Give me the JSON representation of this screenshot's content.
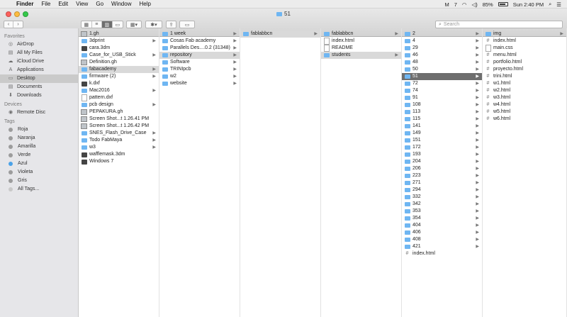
{
  "menubar": {
    "app": "Finder",
    "items": [
      "File",
      "Edit",
      "View",
      "Go",
      "Window",
      "Help"
    ],
    "status_num": "7",
    "battery_text": "85%",
    "battery_level": 0.85,
    "clock": "Sun 2:40 PM"
  },
  "window": {
    "title": "51"
  },
  "toolbar": {
    "search_placeholder": "Search"
  },
  "sidebar": {
    "favorites_header": "Favorites",
    "favorites": [
      "AirDrop",
      "All My Files",
      "iCloud Drive",
      "Applications",
      "Desktop",
      "Documents",
      "Downloads"
    ],
    "devices_header": "Devices",
    "devices": [
      "Remote Disc"
    ],
    "tags_header": "Tags",
    "tags": [
      {
        "label": "Roja",
        "color": "#9c9c9c"
      },
      {
        "label": "Naranja",
        "color": "#9c9c9c"
      },
      {
        "label": "Amarilla",
        "color": "#9c9c9c"
      },
      {
        "label": "Verde",
        "color": "#9c9c9c"
      },
      {
        "label": "Azul",
        "color": "#4aa2e8"
      },
      {
        "label": "Violeta",
        "color": "#9c9c9c"
      },
      {
        "label": "Gris",
        "color": "#9c9c9c"
      },
      {
        "label": "All Tags...",
        "color": "#c9c9c9"
      }
    ]
  },
  "columns": [
    [
      {
        "label": "1.gh",
        "icon": "image"
      },
      {
        "label": "3dprint",
        "icon": "folder",
        "chev": true
      },
      {
        "label": "cara.3dm",
        "icon": "dark"
      },
      {
        "label": "Case_for_USB_Stick",
        "icon": "folder",
        "chev": true
      },
      {
        "label": "Definition.gh",
        "icon": "image"
      },
      {
        "label": "fabacademy",
        "icon": "folder",
        "chev": true,
        "sel": "grey"
      },
      {
        "label": "firmware (2)",
        "icon": "folder",
        "chev": true
      },
      {
        "label": "k.dxf",
        "icon": "dark"
      },
      {
        "label": "Mac2016",
        "icon": "folder",
        "chev": true
      },
      {
        "label": "pattern.dxf",
        "icon": "file"
      },
      {
        "label": "pcb design",
        "icon": "folder",
        "chev": true
      },
      {
        "label": "PEPAKURA.gh",
        "icon": "image"
      },
      {
        "label": "Screen Shot...t 1.26.41 PM",
        "icon": "image"
      },
      {
        "label": "Screen Shot...t 1.26.42 PM",
        "icon": "image"
      },
      {
        "label": "SNES_Flash_Drive_Case",
        "icon": "folder",
        "chev": true
      },
      {
        "label": "Todo FabMaya",
        "icon": "folder",
        "chev": true
      },
      {
        "label": "w3",
        "icon": "folder",
        "chev": true
      },
      {
        "label": "wafflemask.3dm",
        "icon": "dark"
      },
      {
        "label": "Windows 7",
        "icon": "dark"
      }
    ],
    [
      {
        "label": "1 week",
        "icon": "folder",
        "chev": true
      },
      {
        "label": "Cosas Fab academy",
        "icon": "folder",
        "chev": true
      },
      {
        "label": "Parallels Des....0.2 (31348)",
        "icon": "folder",
        "chev": true
      },
      {
        "label": "repository",
        "icon": "folder",
        "chev": true,
        "sel": "grey"
      },
      {
        "label": "Software",
        "icon": "folder",
        "chev": true
      },
      {
        "label": "TRINIpcb",
        "icon": "folder",
        "chev": true
      },
      {
        "label": "w2",
        "icon": "folder",
        "chev": true
      },
      {
        "label": "website",
        "icon": "folder",
        "chev": true
      }
    ],
    [
      {
        "label": "fablabbcn",
        "icon": "folder",
        "chev": true,
        "sel": "grey"
      }
    ],
    [
      {
        "label": "fablabbcn",
        "icon": "folder",
        "chev": true
      },
      {
        "label": "index.html",
        "icon": "file"
      },
      {
        "label": "README",
        "icon": "file"
      },
      {
        "label": "students",
        "icon": "folder",
        "chev": true,
        "sel": "grey"
      }
    ],
    [
      {
        "label": "2",
        "icon": "folder",
        "chev": true
      },
      {
        "label": "4",
        "icon": "folder",
        "chev": true
      },
      {
        "label": "29",
        "icon": "folder",
        "chev": true
      },
      {
        "label": "46",
        "icon": "folder",
        "chev": true
      },
      {
        "label": "48",
        "icon": "folder",
        "chev": true
      },
      {
        "label": "50",
        "icon": "folder",
        "chev": true
      },
      {
        "label": "51",
        "icon": "folder",
        "chev": true,
        "sel": "dark"
      },
      {
        "label": "72",
        "icon": "folder",
        "chev": true
      },
      {
        "label": "74",
        "icon": "folder",
        "chev": true
      },
      {
        "label": "91",
        "icon": "folder",
        "chev": true
      },
      {
        "label": "108",
        "icon": "folder",
        "chev": true
      },
      {
        "label": "113",
        "icon": "folder",
        "chev": true
      },
      {
        "label": "115",
        "icon": "folder",
        "chev": true
      },
      {
        "label": "141",
        "icon": "folder",
        "chev": true
      },
      {
        "label": "149",
        "icon": "folder",
        "chev": true
      },
      {
        "label": "151",
        "icon": "folder",
        "chev": true
      },
      {
        "label": "172",
        "icon": "folder",
        "chev": true
      },
      {
        "label": "193",
        "icon": "folder",
        "chev": true
      },
      {
        "label": "204",
        "icon": "folder",
        "chev": true
      },
      {
        "label": "206",
        "icon": "folder",
        "chev": true
      },
      {
        "label": "223",
        "icon": "folder",
        "chev": true
      },
      {
        "label": "271",
        "icon": "folder",
        "chev": true
      },
      {
        "label": "294",
        "icon": "folder",
        "chev": true
      },
      {
        "label": "332",
        "icon": "folder",
        "chev": true
      },
      {
        "label": "342",
        "icon": "folder",
        "chev": true
      },
      {
        "label": "353",
        "icon": "folder",
        "chev": true
      },
      {
        "label": "354",
        "icon": "folder",
        "chev": true
      },
      {
        "label": "404",
        "icon": "folder",
        "chev": true
      },
      {
        "label": "406",
        "icon": "folder",
        "chev": true
      },
      {
        "label": "408",
        "icon": "folder",
        "chev": true
      },
      {
        "label": "421",
        "icon": "folder",
        "chev": true
      },
      {
        "label": "index.html",
        "icon": "hash"
      }
    ],
    [
      {
        "label": "img",
        "icon": "folder",
        "chev": true
      },
      {
        "label": "index.html",
        "icon": "hash"
      },
      {
        "label": "main.css",
        "icon": "file"
      },
      {
        "label": "menu.html",
        "icon": "hash"
      },
      {
        "label": "portfolio.html",
        "icon": "hash"
      },
      {
        "label": "proyecto.html",
        "icon": "hash"
      },
      {
        "label": "trini.html",
        "icon": "hash"
      },
      {
        "label": "w1.html",
        "icon": "hash"
      },
      {
        "label": "w2.html",
        "icon": "hash"
      },
      {
        "label": "w3.html",
        "icon": "hash"
      },
      {
        "label": "w4.html",
        "icon": "hash"
      },
      {
        "label": "w5.html",
        "icon": "hash"
      },
      {
        "label": "w6.html",
        "icon": "hash"
      }
    ]
  ]
}
